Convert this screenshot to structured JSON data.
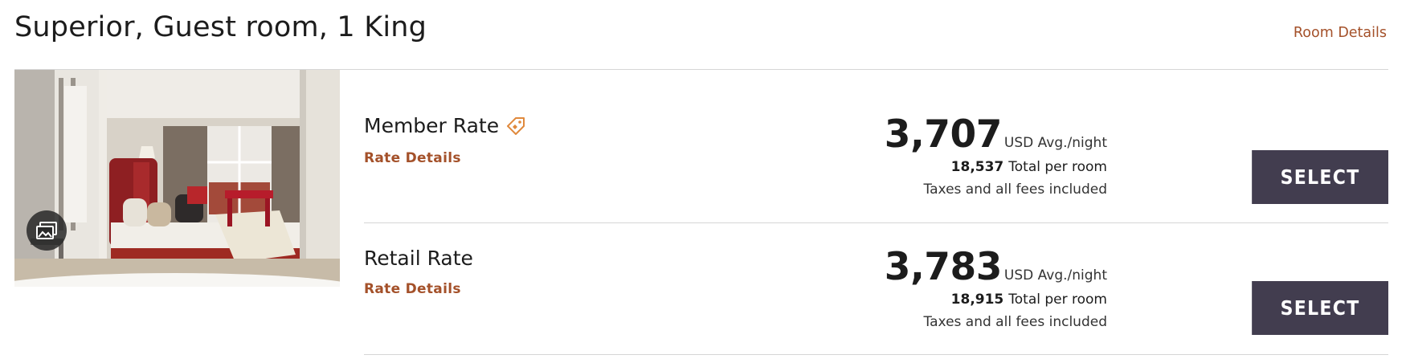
{
  "room": {
    "title": "Superior, Guest room, 1 King",
    "details_link": "Room Details"
  },
  "colors": {
    "accent_link": "#a4512a",
    "select_button_bg": "#423d4f",
    "divider": "#d6d6d6"
  },
  "icons": {
    "gallery": "photo-gallery-icon",
    "member_tag": "price-tag-icon"
  },
  "rates": [
    {
      "name": "Member Rate",
      "has_tag_icon": true,
      "details_label": "Rate Details",
      "price": "3,707",
      "price_unit": "USD Avg./night",
      "total": "18,537",
      "total_label": "Total per room",
      "taxes_note": "Taxes and all fees included",
      "select_label": "SELECT"
    },
    {
      "name": "Retail Rate",
      "has_tag_icon": false,
      "details_label": "Rate Details",
      "price": "3,783",
      "price_unit": "USD Avg./night",
      "total": "18,915",
      "total_label": "Total per room",
      "taxes_note": "Taxes and all fees included",
      "select_label": "SELECT"
    }
  ]
}
